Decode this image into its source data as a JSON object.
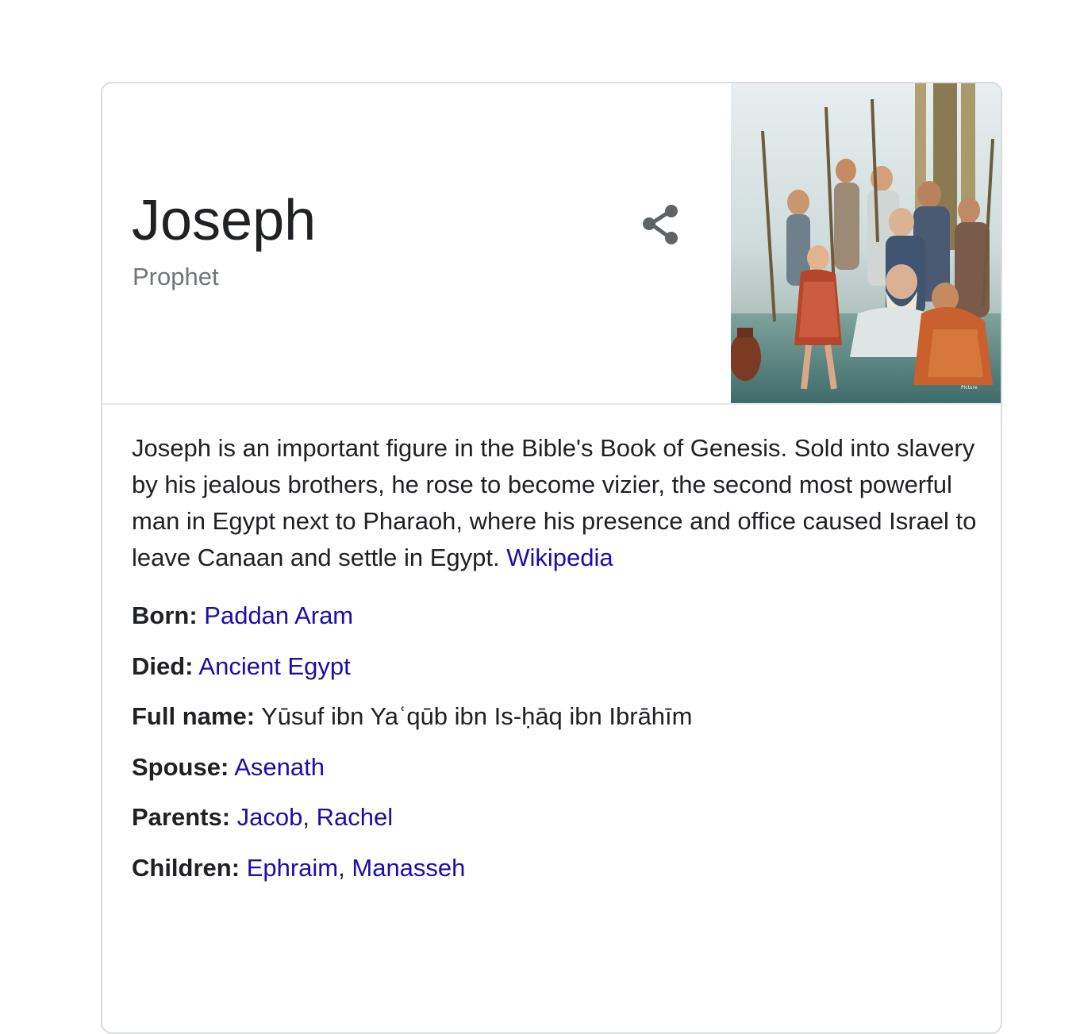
{
  "entity": {
    "title": "Joseph",
    "subtitle": "Prophet",
    "share_icon": "share-icon",
    "image_icon": "painting-thumbnail"
  },
  "description": {
    "text": "Joseph is an important figure in the Bible's Book of Genesis. Sold into slavery by his jealous brothers, he rose to become vizier, the second most powerful man in Egypt next to Pharaoh, where his presence and office caused Israel to leave Canaan and settle in Egypt.",
    "source_link": "Wikipedia"
  },
  "facts": {
    "born": {
      "label": "Born:",
      "value": "Paddan Aram"
    },
    "died": {
      "label": "Died:",
      "value": "Ancient Egypt"
    },
    "full_name": {
      "label": "Full name:",
      "value": "Yūsuf ibn Yaʿqūb ibn Is-ḥāq ibn Ibrāhīm"
    },
    "spouse": {
      "label": "Spouse:",
      "value": "Asenath"
    },
    "parents": {
      "label": "Parents:",
      "values": [
        "Jacob",
        "Rachel"
      ]
    },
    "children": {
      "label": "Children:",
      "values": [
        "Ephraim",
        "Manasseh"
      ]
    },
    "separator": ","
  },
  "colors": {
    "link": "#1a0dab",
    "text": "#202124",
    "muted": "#70757a",
    "border": "#dadce0"
  }
}
